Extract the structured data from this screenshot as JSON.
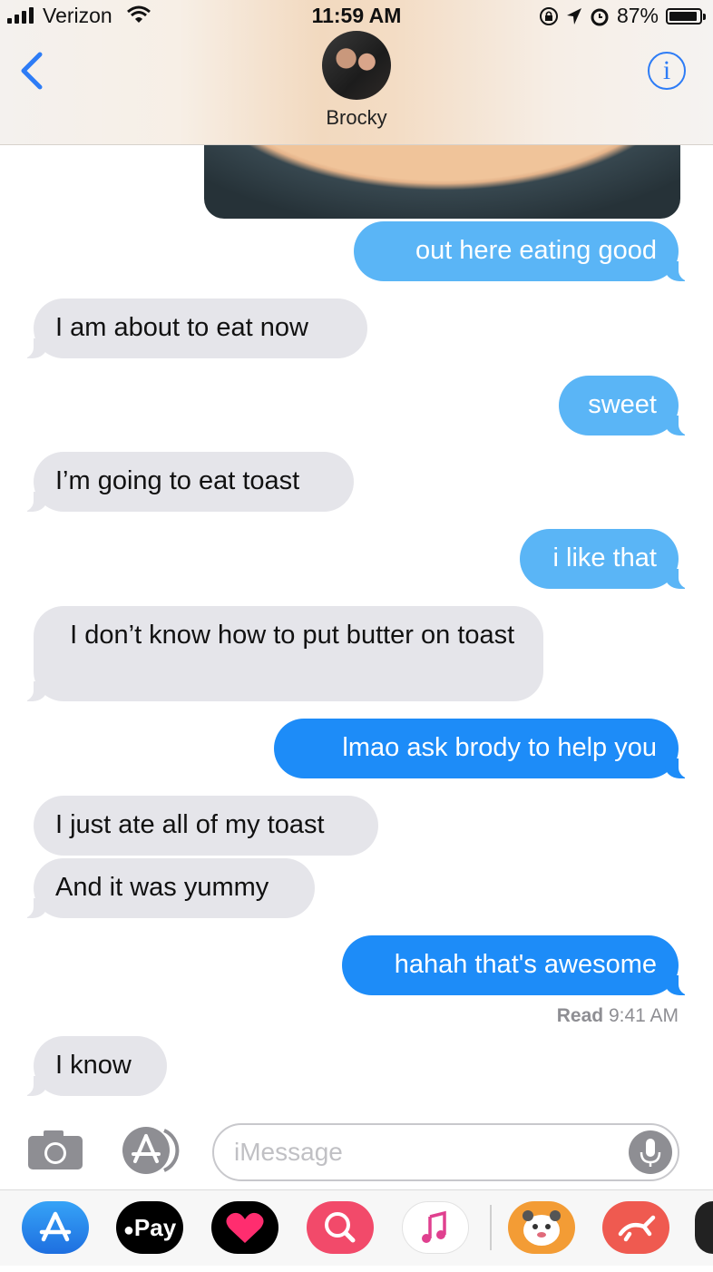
{
  "status_bar": {
    "carrier": "Verizon",
    "time": "11:59 AM",
    "battery": "87%",
    "battery_level": 0.87
  },
  "nav": {
    "contact_name": "Brocky",
    "info_label": "i"
  },
  "messages": [
    {
      "id": 1,
      "side": "out",
      "text": "out here eating good",
      "style": "light"
    },
    {
      "id": 2,
      "side": "in",
      "text": "I am about to eat now"
    },
    {
      "id": 3,
      "side": "out",
      "text": "sweet",
      "style": "light"
    },
    {
      "id": 4,
      "side": "in",
      "text": "I’m going to eat toast"
    },
    {
      "id": 5,
      "side": "out",
      "text": "i like that",
      "style": "light"
    },
    {
      "id": 6,
      "side": "in",
      "text": "  I don’t know how to put butter on toast"
    },
    {
      "id": 7,
      "side": "out",
      "text": "lmao ask brody to help you"
    },
    {
      "id": 8,
      "side": "in",
      "text": "I just ate all of my toast"
    },
    {
      "id": 9,
      "side": "in",
      "text": "And it was yummy"
    },
    {
      "id": 10,
      "side": "out",
      "text": "hahah that's awesome"
    },
    {
      "id": 11,
      "side": "in",
      "text": "I know"
    }
  ],
  "receipt": {
    "label": "Read",
    "time": "9:41 AM"
  },
  "composer": {
    "placeholder": "iMessage"
  },
  "drawer": {
    "apple_pay_label": "Pay",
    "apps": [
      "app-store-icon",
      "apple-pay-icon",
      "digital-touch-icon",
      "web-search-icon",
      "music-icon",
      "sticker-app-icon",
      "rabbit-app-icon"
    ]
  },
  "colors": {
    "outgoing_bubble": "#1d8cf8",
    "outgoing_bubble_light": "#5ab5f6",
    "incoming_bubble": "#e5e5ea",
    "accent": "#2d7cf6"
  }
}
